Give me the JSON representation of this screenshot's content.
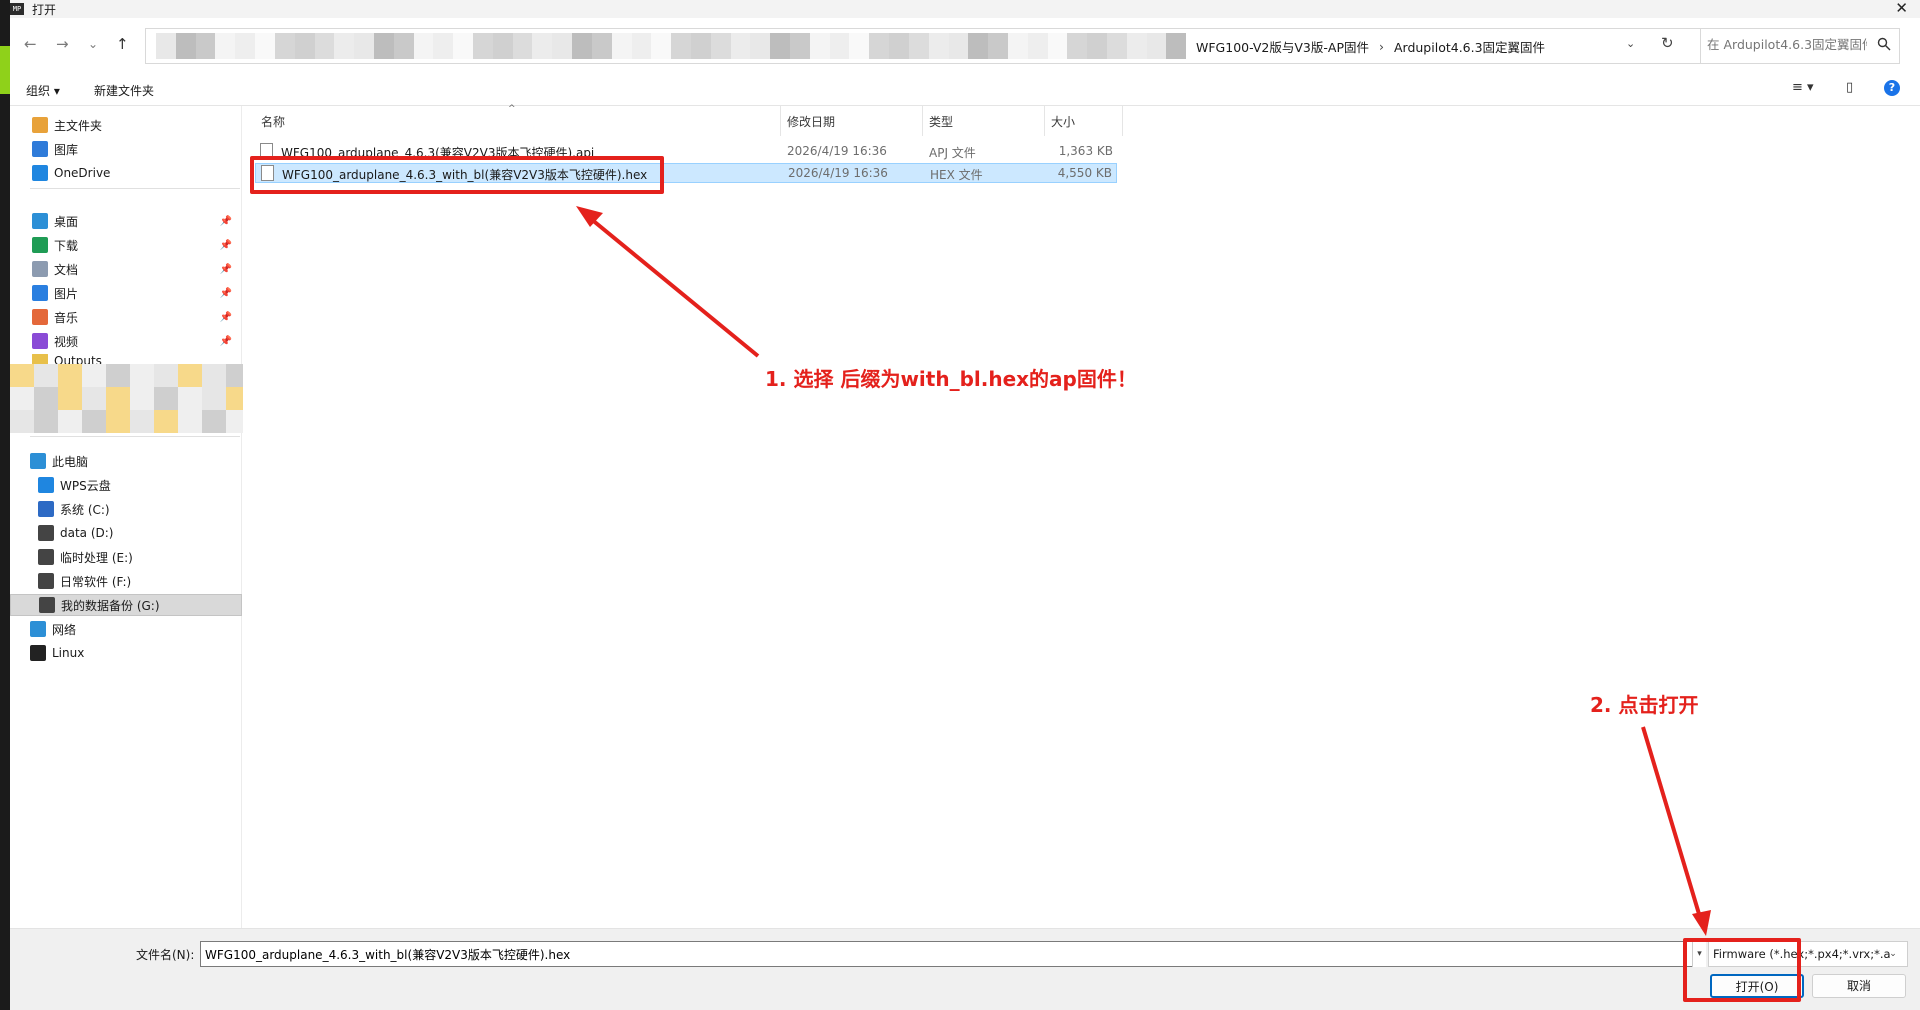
{
  "window": {
    "app_icon_text": "MP",
    "title": "打开",
    "close": "✕"
  },
  "address": {
    "back": "←",
    "forward": "→",
    "recent": "⌄",
    "up": "↑",
    "crumbs": [
      "WFG100-V2版与V3版-AP固件",
      "Ardupilot4.6.3固定翼固件"
    ],
    "crumb_sep": "›",
    "dropdown": "⌄",
    "refresh": "↻"
  },
  "search": {
    "placeholder": "在 Ardupilot4.6.3固定翼固件..."
  },
  "toolbar": {
    "organize": "组织 ▾",
    "new_folder": "新建文件夹",
    "view": "≡ ▾",
    "pane": "▯",
    "help": "?"
  },
  "nav": {
    "quick": [
      {
        "label": "主文件夹",
        "icon": "home-icon",
        "color": "#e8a23a"
      },
      {
        "label": "图库",
        "icon": "gallery-icon",
        "color": "#2f7bd9"
      },
      {
        "label": "OneDrive",
        "icon": "cloud-icon",
        "color": "#1f86e0"
      }
    ],
    "pinned": [
      {
        "label": "桌面",
        "icon": "desktop-icon",
        "color": "#2c8fd6"
      },
      {
        "label": "下载",
        "icon": "download-icon",
        "color": "#1f9c55"
      },
      {
        "label": "文档",
        "icon": "document-icon",
        "color": "#8c9bb0"
      },
      {
        "label": "图片",
        "icon": "pictures-icon",
        "color": "#2a7fe0"
      },
      {
        "label": "音乐",
        "icon": "music-icon",
        "color": "#e4683a"
      },
      {
        "label": "视频",
        "icon": "video-icon",
        "color": "#8a4bd6"
      }
    ],
    "pin_glyph": "📌",
    "truncated_folder": "Outputs",
    "computer": [
      {
        "label": "此电脑",
        "icon": "computer-icon",
        "color": "#2c8fd6",
        "indent": 20
      },
      {
        "label": "WPS云盘",
        "icon": "wps-cloud-icon",
        "color": "#1f86e0",
        "indent": 28
      },
      {
        "label": "系统 (C:)",
        "icon": "drive-c-icon",
        "color": "#2d6ac4",
        "indent": 28
      },
      {
        "label": "data (D:)",
        "icon": "drive-icon",
        "color": "#444444",
        "indent": 28
      },
      {
        "label": "临时处理 (E:)",
        "icon": "drive-icon",
        "color": "#444444",
        "indent": 28
      },
      {
        "label": "日常软件 (F:)",
        "icon": "drive-icon",
        "color": "#444444",
        "indent": 28
      },
      {
        "label": "我的数据备份 (G:)",
        "icon": "drive-icon",
        "color": "#444444",
        "indent": 28,
        "selected": true
      },
      {
        "label": "网络",
        "icon": "network-icon",
        "color": "#2c8fd6",
        "indent": 20
      },
      {
        "label": "Linux",
        "icon": "linux-icon",
        "color": "#222222",
        "indent": 20
      }
    ]
  },
  "list": {
    "columns": [
      "名称",
      "修改日期",
      "类型",
      "大小"
    ],
    "sort_arrow": "^",
    "files": [
      {
        "name": "WFG100_arduplane_4.6.3(兼容V2V3版本飞控硬件).apj",
        "date": "2026/4/19 16:36",
        "type": "APJ 文件",
        "size": "1,363 KB",
        "selected": false
      },
      {
        "name": "WFG100_arduplane_4.6.3_with_bl(兼容V2V3版本飞控硬件).hex",
        "date": "2026/4/19 16:36",
        "type": "HEX 文件",
        "size": "4,550 KB",
        "selected": true
      }
    ]
  },
  "bottom": {
    "filename_label": "文件名(N):",
    "filename_value": "WFG100_arduplane_4.6.3_with_bl(兼容V2V3版本飞控硬件).hex",
    "filter": "Firmware (*.hex;*.px4;*.vrx;*.a",
    "open": "打开(O)",
    "cancel": "取消"
  },
  "annotations": {
    "step1": "1. 选择 后缀为with_bl.hex的ap固件！",
    "step2": "2. 点击打开",
    "color": "#e4211c"
  }
}
